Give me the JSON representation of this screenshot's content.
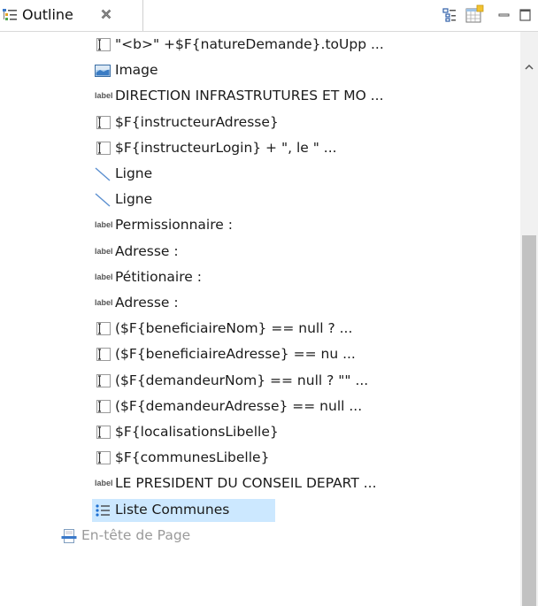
{
  "view": {
    "title": "Outline"
  },
  "tree": {
    "items": [
      {
        "label": "\"<b>\" +$F{natureDemande}.toUpp ...",
        "icon": "text-field-icon"
      },
      {
        "label": "Image",
        "icon": "image-icon"
      },
      {
        "label": "DIRECTION INFRASTRUTURES ET MO ...",
        "icon": "label-icon"
      },
      {
        "label": "$F{instructeurAdresse}",
        "icon": "text-field-icon"
      },
      {
        "label": "$F{instructeurLogin} + \", le \" ...",
        "icon": "text-field-icon"
      },
      {
        "label": "Ligne",
        "icon": "line-icon"
      },
      {
        "label": "Ligne",
        "icon": "line-icon"
      },
      {
        "label": "Permissionnaire :",
        "icon": "label-icon"
      },
      {
        "label": "Adresse :",
        "icon": "label-icon"
      },
      {
        "label": "Pétitionaire :",
        "icon": "label-icon"
      },
      {
        "label": "Adresse :",
        "icon": "label-icon"
      },
      {
        "label": "($F{beneficiaireNom} == null ? ...",
        "icon": "text-field-icon"
      },
      {
        "label": "($F{beneficiaireAdresse} == nu ...",
        "icon": "text-field-icon"
      },
      {
        "label": "($F{demandeurNom} == null ? \"\" ...",
        "icon": "text-field-icon"
      },
      {
        "label": "($F{demandeurAdresse} == null  ...",
        "icon": "text-field-icon"
      },
      {
        "label": "$F{localisationsLibelle}",
        "icon": "text-field-icon"
      },
      {
        "label": "$F{communesLibelle}",
        "icon": "text-field-icon"
      },
      {
        "label": "LE PRESIDENT DU CONSEIL DEPART ...",
        "icon": "label-icon"
      },
      {
        "label": "Liste Communes",
        "icon": "list-icon",
        "selected": true
      },
      {
        "label": "En-tête de Page",
        "icon": "page-header-icon"
      }
    ]
  },
  "icon_labels": {
    "label_glyph": "label"
  },
  "colors": {
    "selection": "#cce8ff",
    "scroll_thumb": "#c2c2c2",
    "accent": "#1f6fd1"
  }
}
